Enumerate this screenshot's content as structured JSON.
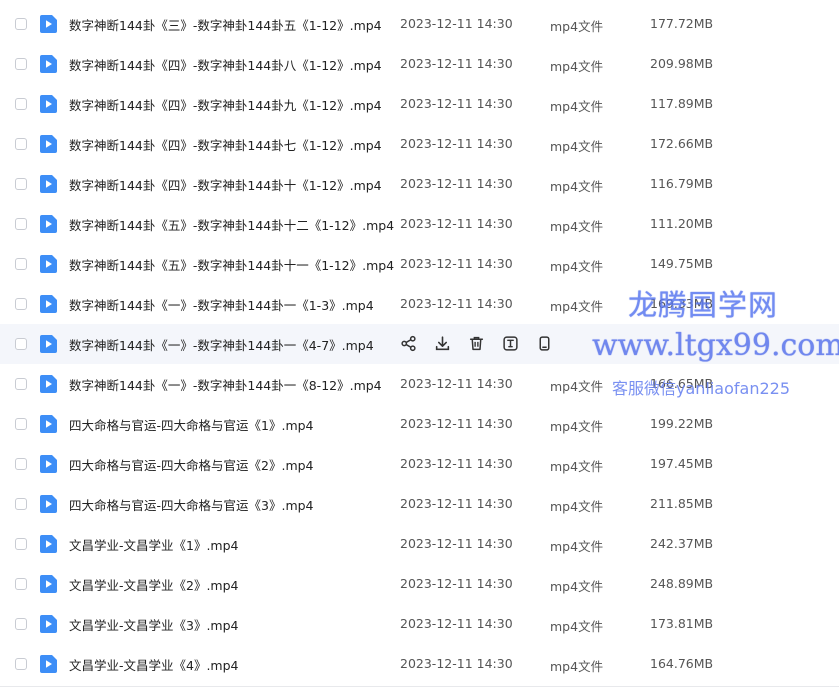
{
  "files": [
    {
      "name": "数字神断144卦《三》-数字神卦144卦五《1-12》.mp4",
      "time": "2023-12-11 14:30",
      "type": "mp4文件",
      "size": "177.72MB"
    },
    {
      "name": "数字神断144卦《四》-数字神卦144卦八《1-12》.mp4",
      "time": "2023-12-11 14:30",
      "type": "mp4文件",
      "size": "209.98MB"
    },
    {
      "name": "数字神断144卦《四》-数字神卦144卦九《1-12》.mp4",
      "time": "2023-12-11 14:30",
      "type": "mp4文件",
      "size": "117.89MB"
    },
    {
      "name": "数字神断144卦《四》-数字神卦144卦七《1-12》.mp4",
      "time": "2023-12-11 14:30",
      "type": "mp4文件",
      "size": "172.66MB"
    },
    {
      "name": "数字神断144卦《四》-数字神卦144卦十《1-12》.mp4",
      "time": "2023-12-11 14:30",
      "type": "mp4文件",
      "size": "116.79MB"
    },
    {
      "name": "数字神断144卦《五》-数字神卦144卦十二《1-12》.mp4",
      "time": "2023-12-11 14:30",
      "type": "mp4文件",
      "size": "111.20MB"
    },
    {
      "name": "数字神断144卦《五》-数字神卦144卦十一《1-12》.mp4",
      "time": "2023-12-11 14:30",
      "type": "mp4文件",
      "size": "149.75MB"
    },
    {
      "name": "数字神断144卦《一》-数字神卦144卦一《1-3》.mp4",
      "time": "2023-12-11 14:30",
      "type": "mp4文件",
      "size": "169.33MB"
    },
    {
      "name": "数字神断144卦《一》-数字神卦144卦一《4-7》.mp4",
      "time": "",
      "type": "",
      "size": "",
      "hover": true
    },
    {
      "name": "数字神断144卦《一》-数字神卦144卦一《8-12》.mp4",
      "time": "2023-12-11 14:30",
      "type": "mp4文件",
      "size": "166.65MB"
    },
    {
      "name": "四大命格与官运-四大命格与官运《1》.mp4",
      "time": "2023-12-11 14:30",
      "type": "mp4文件",
      "size": "199.22MB"
    },
    {
      "name": "四大命格与官运-四大命格与官运《2》.mp4",
      "time": "2023-12-11 14:30",
      "type": "mp4文件",
      "size": "197.45MB"
    },
    {
      "name": "四大命格与官运-四大命格与官运《3》.mp4",
      "time": "2023-12-11 14:30",
      "type": "mp4文件",
      "size": "211.85MB"
    },
    {
      "name": "文昌学业-文昌学业《1》.mp4",
      "time": "2023-12-11 14:30",
      "type": "mp4文件",
      "size": "242.37MB"
    },
    {
      "name": "文昌学业-文昌学业《2》.mp4",
      "time": "2023-12-11 14:30",
      "type": "mp4文件",
      "size": "248.89MB"
    },
    {
      "name": "文昌学业-文昌学业《3》.mp4",
      "time": "2023-12-11 14:30",
      "type": "mp4文件",
      "size": "173.81MB"
    },
    {
      "name": "文昌学业-文昌学业《4》.mp4",
      "time": "2023-12-11 14:30",
      "type": "mp4文件",
      "size": "164.76MB"
    }
  ],
  "row_actions": [
    "share-icon",
    "download-icon",
    "delete-icon",
    "rename-icon",
    "copy-icon"
  ],
  "watermark": {
    "title": "龙腾国学网",
    "url": "www.ltgx99.com",
    "wechat": "客服微信yanliaofan225"
  },
  "colors": {
    "file_icon": "#3d8ef7",
    "hover_row": "#f4f6fb"
  }
}
